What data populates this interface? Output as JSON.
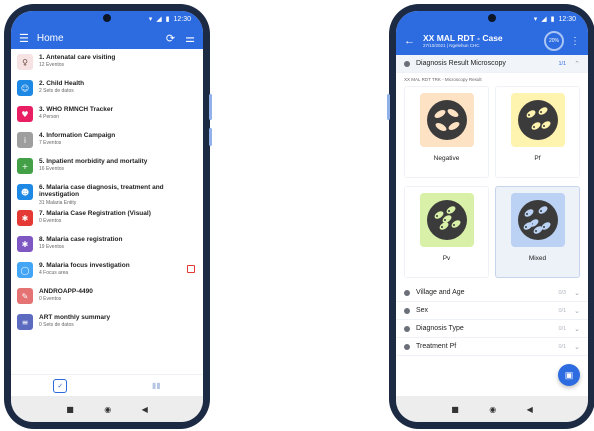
{
  "left_phone": {
    "status": {
      "time": "12:30"
    },
    "appbar": {
      "title": "Home"
    },
    "programs": [
      {
        "name": "1. Antenatal care visiting",
        "sub": "12 Eventos",
        "color": "#f6e2e2",
        "icon": "pregnant-woman-icon",
        "glyph": "♀"
      },
      {
        "name": "2. Child Health",
        "sub": "2 Sets de datos",
        "color": "#1e88e5",
        "icon": "child-icon",
        "glyph": "☺"
      },
      {
        "name": "3. WHO RMNCH Tracker",
        "sub": "4 Person",
        "color": "#e91e63",
        "icon": "family-icon",
        "glyph": "♥"
      },
      {
        "name": "4. Information Campaign",
        "sub": "7 Eventos",
        "color": "#9e9e9e",
        "icon": "campaign-icon",
        "glyph": "i"
      },
      {
        "name": "5. Inpatient morbidity and mortality",
        "sub": "16 Eventos",
        "color": "#43a047",
        "icon": "hospital-bed-icon",
        "glyph": "+"
      },
      {
        "name": "6. Malaria case diagnosis, treatment and investigation",
        "sub": "31 Malaria Entity",
        "color": "#1e88e5",
        "icon": "person-icon",
        "glyph": "☻"
      },
      {
        "name": "7. Malaria Case Registration (Visual)",
        "sub": "0 Eventos",
        "color": "#e53935",
        "icon": "virus-icon",
        "glyph": "✱"
      },
      {
        "name": "8. Malaria case registration",
        "sub": "19 Eventos",
        "color": "#7e57c2",
        "icon": "virus-icon",
        "glyph": "✱"
      },
      {
        "name": "9. Malaria focus investigation",
        "sub": "4 Focus area",
        "color": "#42a5f5",
        "icon": "location-icon",
        "glyph": "◯"
      },
      {
        "name": "ANDROAPP-4490",
        "sub": "0 Eventos",
        "color": "#e57373",
        "icon": "form-icon",
        "glyph": "✎"
      },
      {
        "name": "ART monthly summary",
        "sub": "0 Sets de datos",
        "color": "#5c6bc0",
        "icon": "document-icon",
        "glyph": "≡"
      }
    ]
  },
  "right_phone": {
    "status": {
      "time": "12:30"
    },
    "appbar": {
      "title": "XX MAL RDT - Case",
      "subtitle": "27/10/2021 | Ngelehun CHC",
      "progress": "20%"
    },
    "sections": [
      {
        "title": "Diagnosis Result Microscopy",
        "count": "1/1",
        "open": true
      },
      {
        "title": "Village and Age",
        "count": "0/3",
        "open": false
      },
      {
        "title": "Sex",
        "count": "0/1",
        "open": false
      },
      {
        "title": "Diagnosis Type",
        "count": "0/1",
        "open": false
      },
      {
        "title": "Treatment Pf",
        "count": "0/1",
        "open": false
      }
    ],
    "question_label": "XX MAL RDT TRK - Microscopy Result",
    "options": [
      {
        "label": "Negative",
        "bg": "#fde2c4",
        "selected": false
      },
      {
        "label": "Pf",
        "bg": "#fff3b0",
        "selected": false
      },
      {
        "label": "Pv",
        "bg": "#d9f0a8",
        "selected": false
      },
      {
        "label": "Mixed",
        "bg": "#bcd2f5",
        "selected": true
      }
    ]
  }
}
